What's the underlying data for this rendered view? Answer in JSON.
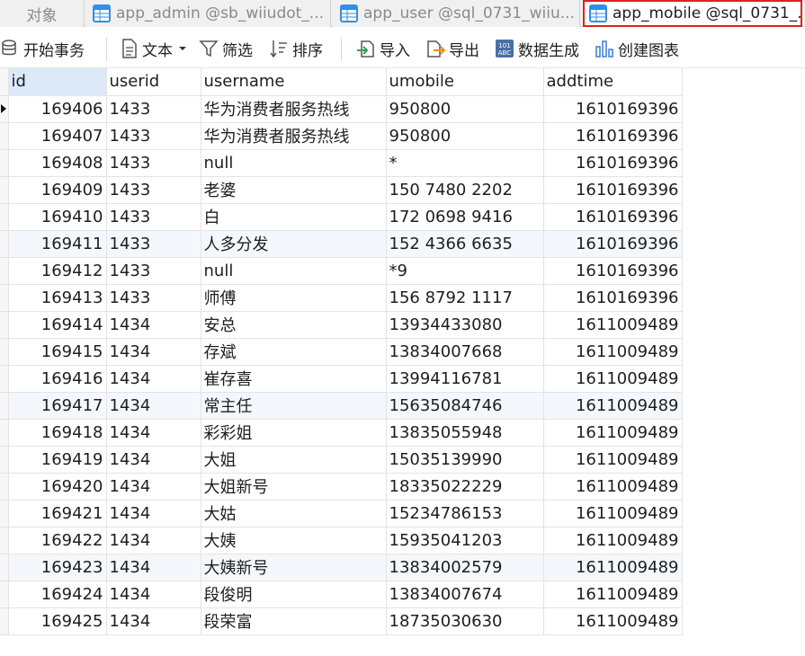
{
  "tabs": {
    "objects": "对象",
    "items": [
      {
        "label": "app_admin @sb_wiiudot_..."
      },
      {
        "label": "app_user @sql_0731_wiiu..."
      },
      {
        "label": "app_mobile @sql_0731_..."
      }
    ]
  },
  "toolbar": {
    "begin_transaction": "开始事务",
    "text": "文本",
    "filter": "筛选",
    "sort": "排序",
    "import": "导入",
    "export": "导出",
    "generate_data": "数据生成",
    "create_chart": "创建图表"
  },
  "grid": {
    "columns": [
      "id",
      "userid",
      "username",
      "umobile",
      "addtime"
    ],
    "rows": [
      [
        "169406",
        "1433",
        "华为消费者服务热线",
        "950800",
        "1610169396"
      ],
      [
        "169407",
        "1433",
        "华为消费者服务热线",
        "950800",
        "1610169396"
      ],
      [
        "169408",
        "1433",
        "null",
        "*",
        "1610169396"
      ],
      [
        "169409",
        "1433",
        "老婆",
        "150 7480 2202",
        "1610169396"
      ],
      [
        "169410",
        "1433",
        "白",
        "172 0698 9416",
        "1610169396"
      ],
      [
        "169411",
        "1433",
        "人多分发",
        "152 4366 6635",
        "1610169396"
      ],
      [
        "169412",
        "1433",
        "null",
        "*9",
        "1610169396"
      ],
      [
        "169413",
        "1433",
        "师傅",
        "156 8792 1117",
        "1610169396"
      ],
      [
        "169414",
        "1434",
        "安总",
        "13934433080",
        "1611009489"
      ],
      [
        "169415",
        "1434",
        "存斌",
        "13834007668",
        "1611009489"
      ],
      [
        "169416",
        "1434",
        "崔存喜",
        "13994116781",
        "1611009489"
      ],
      [
        "169417",
        "1434",
        "常主任",
        "15635084746",
        "1611009489"
      ],
      [
        "169418",
        "1434",
        "彩彩姐",
        "13835055948",
        "1611009489"
      ],
      [
        "169419",
        "1434",
        "大姐",
        "15035139990",
        "1611009489"
      ],
      [
        "169420",
        "1434",
        "大姐新号",
        "18335022229",
        "1611009489"
      ],
      [
        "169421",
        "1434",
        "大姑",
        "15234786153",
        "1611009489"
      ],
      [
        "169422",
        "1434",
        "大姨",
        "15935041203",
        "1611009489"
      ],
      [
        "169423",
        "1434",
        "大姨新号",
        "13834002579",
        "1611009489"
      ],
      [
        "169424",
        "1434",
        "段俊明",
        "13834007674",
        "1611009489"
      ],
      [
        "169425",
        "1434",
        "段荣富",
        "18735030630",
        "1611009489"
      ]
    ]
  },
  "colors": {
    "active_tab_border": "#e02020",
    "table_icon": "#2f8fe8",
    "selected_header": "#dce9f8"
  }
}
